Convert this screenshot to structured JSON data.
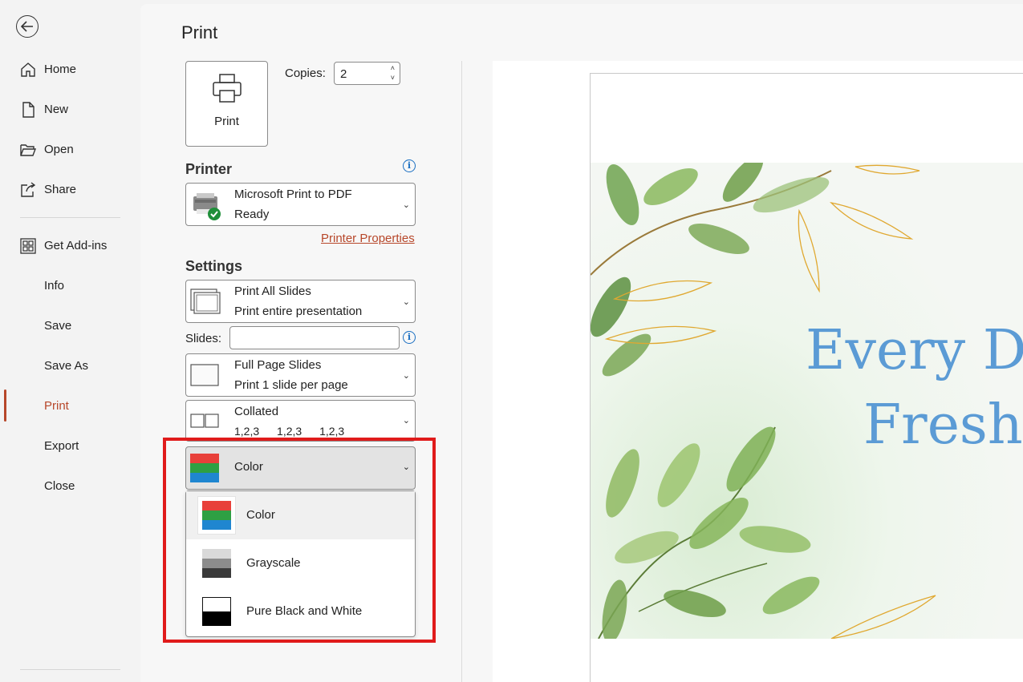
{
  "nav": {
    "items": [
      {
        "label": "Home",
        "icon": "home-icon"
      },
      {
        "label": "New",
        "icon": "new-document-icon"
      },
      {
        "label": "Open",
        "icon": "folder-open-icon"
      },
      {
        "label": "Share",
        "icon": "share-icon"
      },
      {
        "label": "Get Add-ins",
        "icon": "grid-addins-icon"
      },
      {
        "label": "Info"
      },
      {
        "label": "Save"
      },
      {
        "label": "Save As"
      },
      {
        "label": "Print",
        "active": true
      },
      {
        "label": "Export"
      },
      {
        "label": "Close"
      }
    ]
  },
  "page": {
    "title": "Print"
  },
  "print_button": {
    "label": "Print"
  },
  "copies": {
    "label": "Copies:",
    "value": "2"
  },
  "printer": {
    "section": "Printer",
    "name": "Microsoft Print to PDF",
    "status": "Ready",
    "properties_link": "Printer Properties"
  },
  "settings": {
    "section": "Settings",
    "range": {
      "title": "Print All Slides",
      "sub": "Print entire presentation"
    },
    "slides_label": "Slides:",
    "slides_value": "",
    "layout": {
      "title": "Full Page Slides",
      "sub": "Print 1 slide per page"
    },
    "collation": {
      "title": "Collated",
      "nums": [
        "1,2,3",
        "1,2,3",
        "1,2,3"
      ]
    },
    "color": {
      "selected": "Color"
    }
  },
  "color_menu": {
    "options": [
      "Color",
      "Grayscale",
      "Pure Black and White"
    ],
    "selected": "Color"
  },
  "preview": {
    "line1": "Every D",
    "line2": "Fresh"
  },
  "colors": {
    "accent": "#b7472a",
    "highlight": "#e01b1b",
    "title_blue": "#5b9bd5"
  }
}
